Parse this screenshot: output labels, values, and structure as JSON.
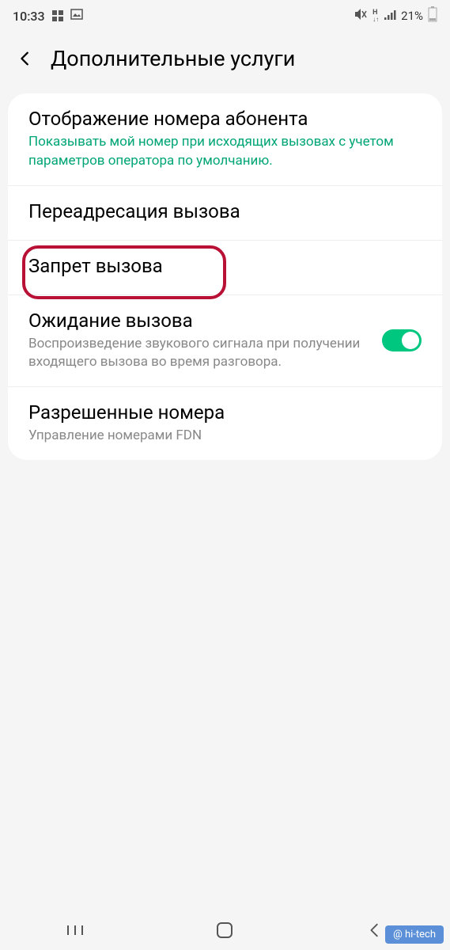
{
  "statusBar": {
    "time": "10:33",
    "batteryPercent": "21%"
  },
  "header": {
    "title": "Дополнительные услуги"
  },
  "items": {
    "callerID": {
      "title": "Отображение номера абонента",
      "subtitle": "Показывать мой номер при исходящих вызовах с учетом параметров оператора по умолчанию."
    },
    "callForwarding": {
      "title": "Переадресация вызова"
    },
    "callBarring": {
      "title": "Запрет вызова"
    },
    "callWaiting": {
      "title": "Ожидание вызова",
      "subtitle": "Воспроизведение звукового сигнала при получении входящего вызова во время разговора.",
      "enabled": true
    },
    "allowedNumbers": {
      "title": "Разрешенные номера",
      "subtitle": "Управление номерами FDN"
    }
  },
  "watermark": {
    "text": "@ hi-tech"
  }
}
